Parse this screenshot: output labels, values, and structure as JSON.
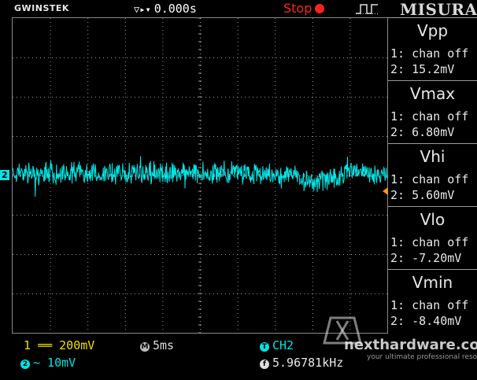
{
  "topbar": {
    "brand": "GWINSTEK",
    "trigger_delay": "0.000s",
    "run_state": "Stop",
    "mode_label": "MISURA"
  },
  "colors": {
    "ch1": "#f0e000",
    "ch2": "#00e5e5",
    "stop": "#ff2020",
    "trigger_level": "#ff9a00",
    "grid": "#9a9a9a"
  },
  "channel_marker": "2",
  "measurements": [
    {
      "name": "Vpp",
      "ch1": "1: chan off",
      "ch2": "2: 15.2mV"
    },
    {
      "name": "Vmax",
      "ch1": "1: chan off",
      "ch2": "2: 6.80mV"
    },
    {
      "name": "Vhi",
      "ch1": "1: chan off",
      "ch2": "2: 5.60mV"
    },
    {
      "name": "Vlo",
      "ch1": "1: chan off",
      "ch2": "2: -7.20mV"
    },
    {
      "name": "Vmin",
      "ch1": "1: chan off",
      "ch2": "2: -8.40mV"
    }
  ],
  "status": {
    "ch1_badge": "1",
    "ch1_scale": "══ 200mV",
    "ch2_badge": "2",
    "ch2_scale": "∼ 10mV",
    "time_badge": "M",
    "time_scale": "5ms",
    "trigger_badge": "T",
    "trigger_source": "CH2",
    "freq_badge": "f",
    "frequency": "5.96781kHz"
  },
  "watermark": {
    "name": "nexthardware.com",
    "tagline": "your ultimate professional resource"
  }
}
